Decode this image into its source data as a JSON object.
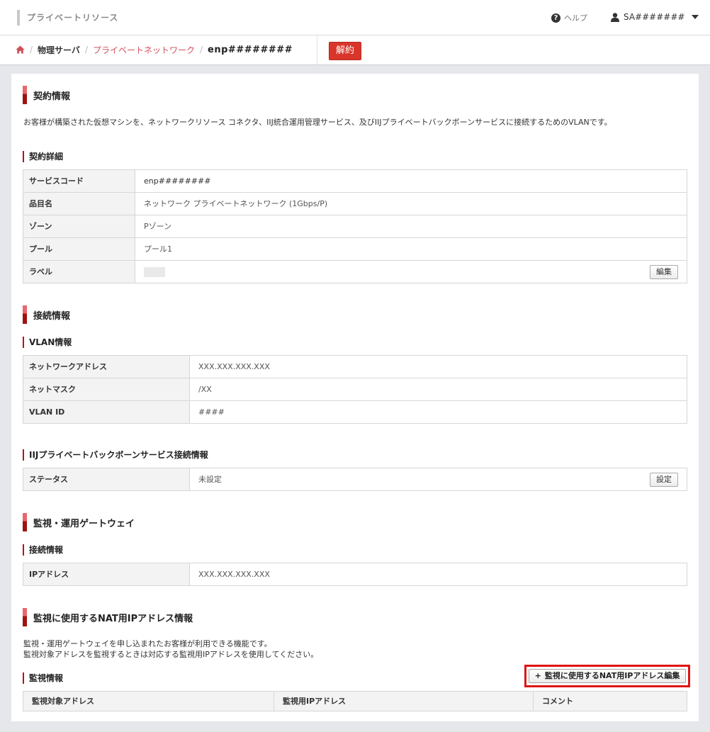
{
  "header": {
    "app_title": "プライベートリソース",
    "help_label": "ヘルプ",
    "user_name": "SA#######"
  },
  "breadcrumb": {
    "physical_server": "物理サーバ",
    "private_network": "プライベートネットワーク",
    "current": "enp########",
    "cancel_button": "解約"
  },
  "contract": {
    "heading": "契約情報",
    "description": "お客様が構築された仮想マシンを、ネットワークリソース コネクタ、IIJ統合運用管理サービス、及びIIJプライベートバックボーンサービスに接続するためのVLANです。",
    "detail_heading": "契約詳細",
    "rows": [
      {
        "label": "サービスコード",
        "value": "enp########"
      },
      {
        "label": "品目名",
        "value": "ネットワーク プライベートネットワーク (1Gbps/P)"
      },
      {
        "label": "ゾーン",
        "value": "Pゾーン"
      },
      {
        "label": "プール",
        "value": "プール1"
      },
      {
        "label": "ラベル",
        "value": ""
      }
    ],
    "edit_button": "編集"
  },
  "connection": {
    "heading": "接続情報",
    "vlan_heading": "VLAN情報",
    "vlan_rows": [
      {
        "label": "ネットワークアドレス",
        "value": "XXX.XXX.XXX.XXX"
      },
      {
        "label": "ネットマスク",
        "value": "/XX"
      },
      {
        "label": "VLAN ID",
        "value": "####"
      }
    ],
    "backbone_heading": "IIJプライベートバックボーンサービス接続情報",
    "status_label": "ステータス",
    "status_value": "未設定",
    "settings_button": "設定"
  },
  "gateway": {
    "heading": "監視・運用ゲートウェイ",
    "sub_heading": "接続情報",
    "ip_label": "IPアドレス",
    "ip_value": "XXX.XXX.XXX.XXX"
  },
  "nat": {
    "heading": "監視に使用するNAT用IPアドレス情報",
    "description_line1": "監視・運用ゲートウェイを申し込まれたお客様が利用できる機能です。",
    "description_line2": "監視対象アドレスを監視するときは対応する監視用IPアドレスを使用してください。",
    "edit_button": "監視に使用するNAT用IPアドレス編集",
    "monitor_heading": "監視情報",
    "columns": [
      "監視対象アドレス",
      "監視用IPアドレス",
      "コメント"
    ]
  },
  "colors": {
    "accent_red": "#d9352a",
    "link_pink": "#d0505a",
    "highlight_red": "#e01313"
  }
}
